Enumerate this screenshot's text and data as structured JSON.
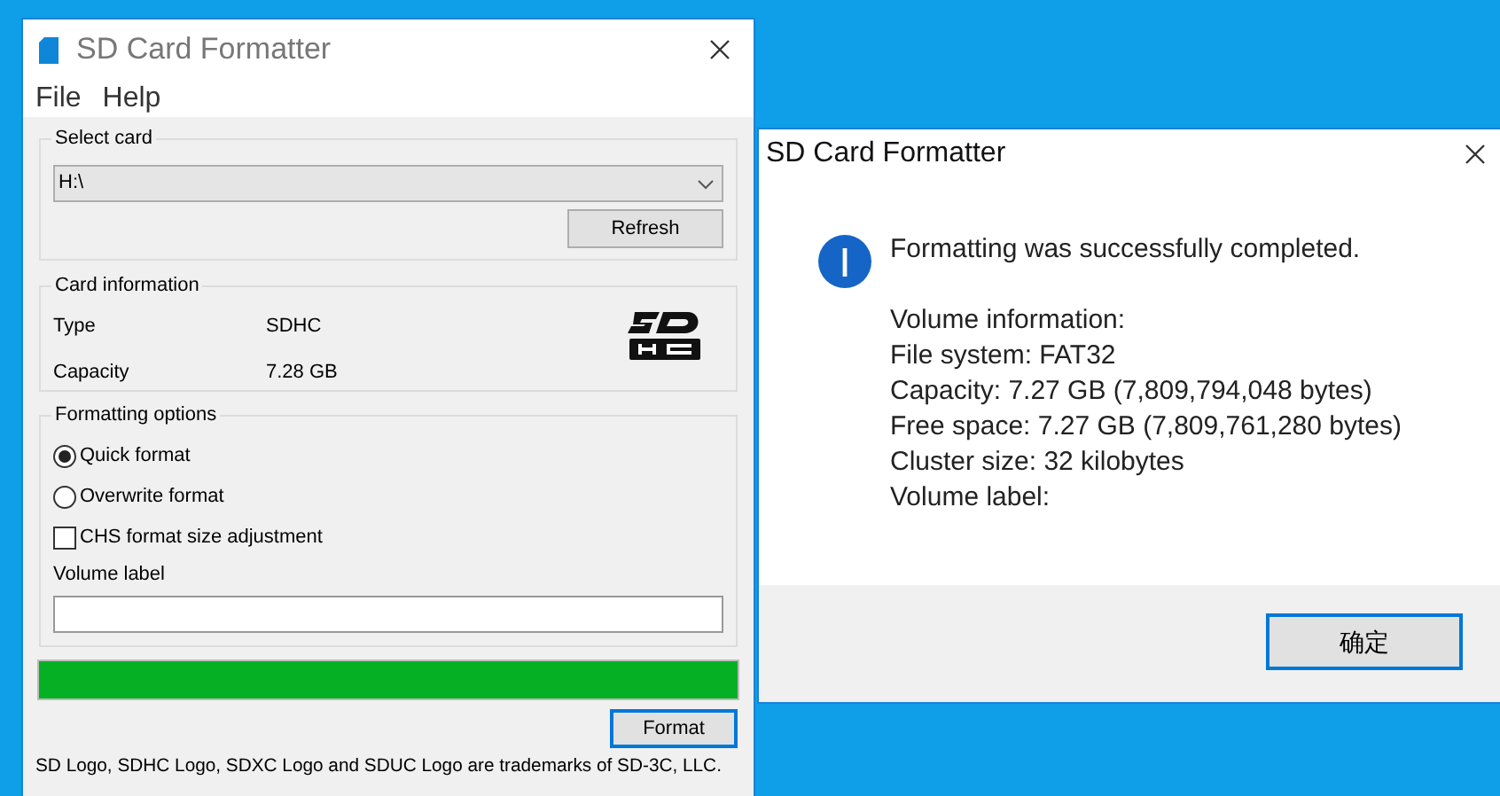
{
  "main_window": {
    "title": "SD Card Formatter",
    "menu": [
      "File",
      "Help"
    ],
    "select_card": {
      "label": "Select card",
      "value": "H:\\",
      "refresh": "Refresh"
    },
    "card_information": {
      "label": "Card information",
      "rows": [
        {
          "name": "Type",
          "value": "SDHC"
        },
        {
          "name": "Capacity",
          "value": "7.28 GB"
        }
      ]
    },
    "formatting_options": {
      "label": "Formatting options",
      "options": [
        {
          "kind": "radio",
          "label": "Quick format",
          "selected": true
        },
        {
          "kind": "radio",
          "label": "Overwrite format",
          "selected": false
        },
        {
          "kind": "checkbox",
          "label": "CHS format size adjustment",
          "checked": false
        }
      ],
      "volume_label": "Volume label"
    },
    "progress": {
      "level": 1
    },
    "format_button": "Format",
    "footer": "SD Logo, SDHC Logo, SDXC Logo and SDUC Logo are trademarks of SD-3C, LLC."
  },
  "dialog": {
    "title": "SD Card Formatter",
    "message": "Formatting was successfully completed.",
    "details": [
      "Volume information:",
      "File system: FAT32",
      "Capacity: 7.27 GB (7,809,794,048 bytes)",
      "Free space: 7.27 GB (7,809,761,280 bytes)",
      "Cluster size: 32 kilobytes",
      "Volume label:"
    ],
    "ok_button": "确定"
  }
}
